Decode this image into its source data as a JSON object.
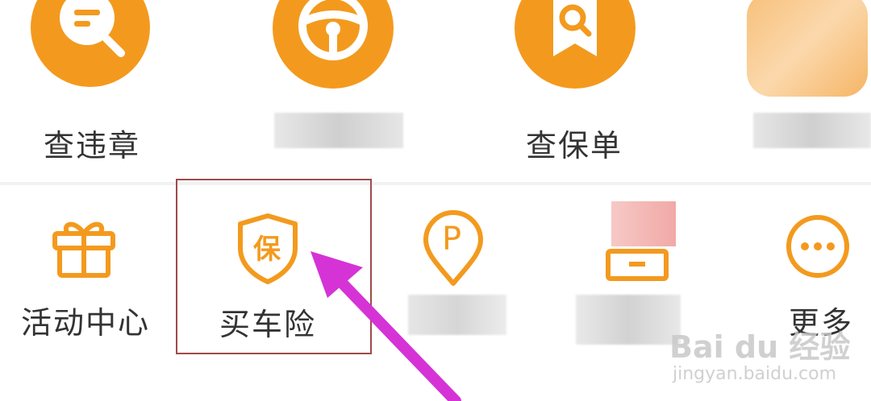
{
  "colors": {
    "accent": "#f39a1e",
    "arrow": "#d533d6",
    "highlight_box": "#a04a4a"
  },
  "row1": [
    {
      "label": "查违章",
      "icon": "search-message-icon"
    },
    {
      "label": "",
      "icon": "steering-wheel-icon"
    },
    {
      "label": "查保单",
      "icon": "policy-search-icon"
    },
    {
      "label": "",
      "icon": "blurred-icon"
    }
  ],
  "row2": [
    {
      "label": "活动中心",
      "icon": "gift-icon"
    },
    {
      "label": "买车险",
      "icon": "insurance-shield-icon",
      "glyph": "保"
    },
    {
      "label": "",
      "icon": "parking-pin-icon",
      "glyph": "P"
    },
    {
      "label": "",
      "icon": "blurred-icon"
    },
    {
      "label": "更多",
      "icon": "more-icon"
    }
  ],
  "watermark": {
    "brand": "Bai du 经验",
    "url": "jingyan.baidu.com"
  }
}
